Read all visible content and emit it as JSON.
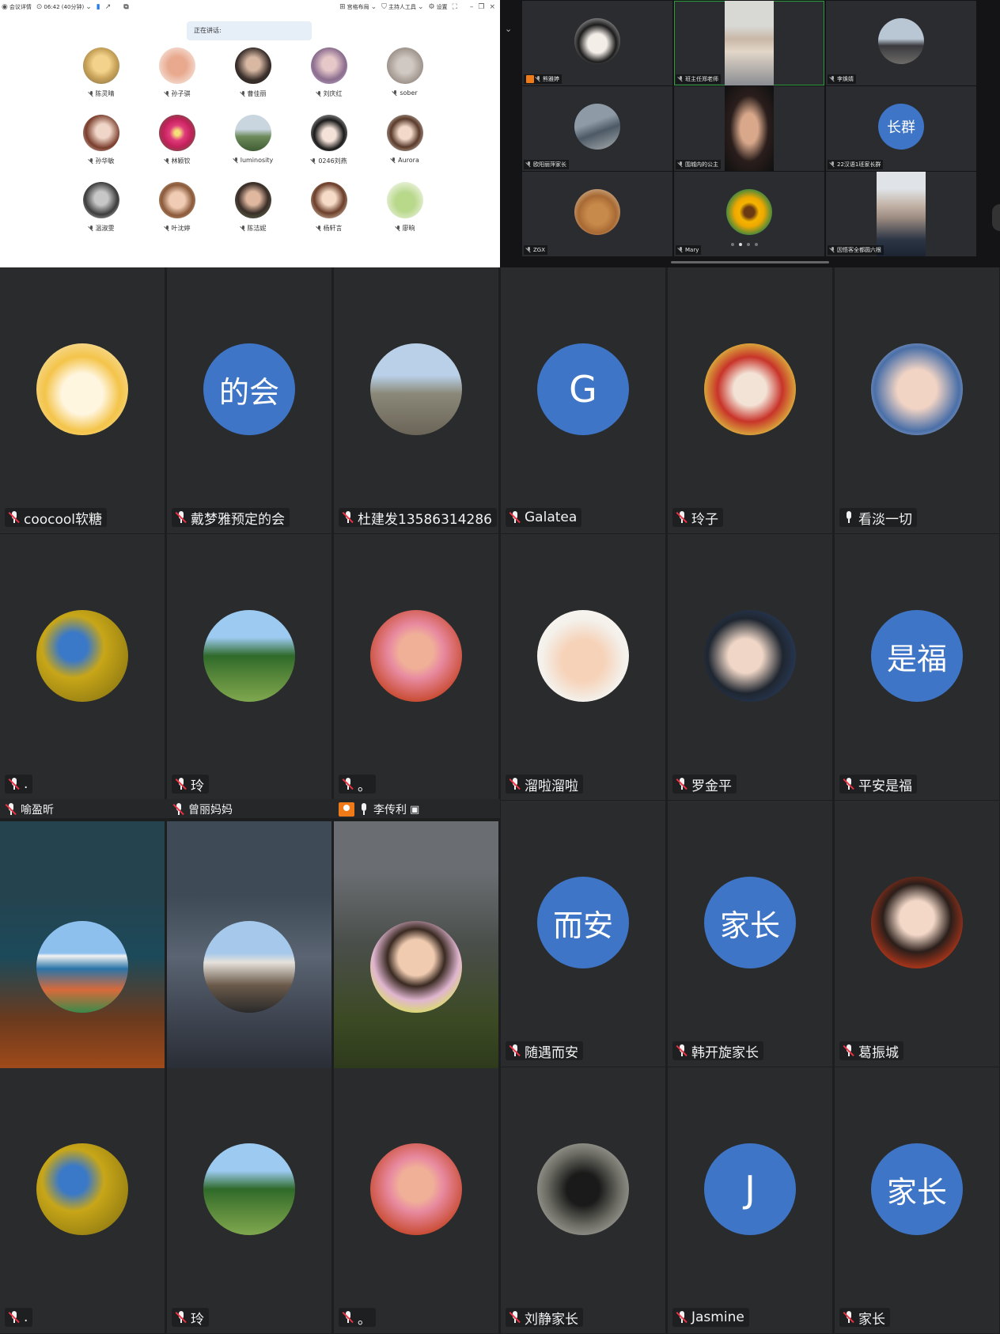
{
  "topbar": {
    "app_name": "会议详情",
    "time": "06:42 (40分钟)",
    "layout_btn": "宫格布局",
    "host_tools_btn": "主持人工具",
    "settings_btn": "设置"
  },
  "speaking": {
    "label": "正在讲话:"
  },
  "light_grid": [
    {
      "name": "陈灵晴"
    },
    {
      "name": "孙子骐"
    },
    {
      "name": "曹佳丽"
    },
    {
      "name": "刘庆红"
    },
    {
      "name": "sober"
    },
    {
      "name": "孙华敏"
    },
    {
      "name": "林颖钦"
    },
    {
      "name": "luminosity"
    },
    {
      "name": "0246刘燕"
    },
    {
      "name": "Aurora"
    },
    {
      "name": "温淑雯"
    },
    {
      "name": "叶沈婷"
    },
    {
      "name": "陈洁妮"
    },
    {
      "name": "杨轩言"
    },
    {
      "name": "廖晌"
    }
  ],
  "top_right": {
    "cells": [
      {
        "name": "熊雅婷",
        "host": true
      },
      {
        "name": "班主任郑老师",
        "selected": true
      },
      {
        "name": "李焕婧"
      },
      {
        "name": "欧阳丽萍家长"
      },
      {
        "name": "围城内的公主"
      },
      {
        "name": "22汉语1班家长群",
        "initial": "长群"
      },
      {
        "name": "ZGX"
      },
      {
        "name": "Mary"
      },
      {
        "name": "因悟客全都圆六根"
      }
    ],
    "page_dots": 4,
    "active_dot": 1
  },
  "tiles": [
    {
      "name": "coocool软糖",
      "muted": true
    },
    {
      "name": "戴梦雅预定的会",
      "muted": true,
      "initial": "的会"
    },
    {
      "name": "杜建发13586314286",
      "muted": true
    },
    {
      "name": "Galatea",
      "muted": true,
      "initial": "G"
    },
    {
      "name": "玲子",
      "muted": true
    },
    {
      "name": "看淡一切",
      "muted": false
    },
    {
      "name": ".",
      "muted": true
    },
    {
      "name": "玲",
      "muted": true
    },
    {
      "name": "。",
      "muted": true
    },
    {
      "name": "溜啦溜啦",
      "muted": true
    },
    {
      "name": "罗金平",
      "muted": true
    },
    {
      "name": "平安是福",
      "muted": true,
      "initial": "是福"
    },
    {
      "name": "随遇而安",
      "muted": true,
      "initial": "而安"
    },
    {
      "name": "韩开旋家长",
      "muted": true,
      "initial": "家长"
    },
    {
      "name": "葛振城",
      "muted": true
    },
    {
      "name": ".",
      "muted": true
    },
    {
      "name": "玲",
      "muted": true
    },
    {
      "name": "。",
      "muted": true
    },
    {
      "name": "刘静家长",
      "muted": true
    },
    {
      "name": "Jasmine",
      "muted": true,
      "initial": "J"
    },
    {
      "name": "家长",
      "muted": true,
      "initial": "家长"
    }
  ],
  "strip": [
    {
      "name": "喻盈昕"
    },
    {
      "name": "曾丽妈妈"
    },
    {
      "name": "李传利"
    }
  ]
}
